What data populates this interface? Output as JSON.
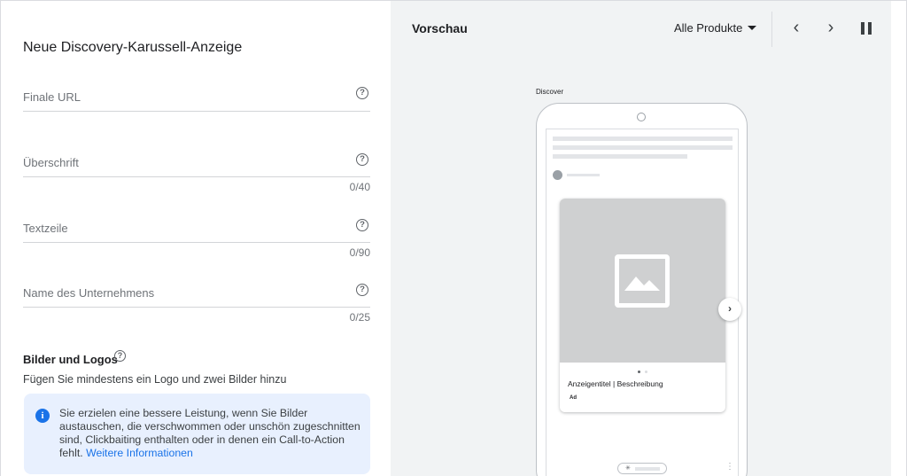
{
  "form": {
    "title": "Neue Discovery-Karussell-Anzeige",
    "fields": [
      {
        "label": "Finale URL",
        "counter": ""
      },
      {
        "label": "Überschrift",
        "counter": "0/40"
      },
      {
        "label": "Textzeile",
        "counter": "0/90"
      },
      {
        "label": "Name des Unternehmens",
        "counter": "0/25"
      }
    ],
    "help_glyph": "?",
    "images_section": {
      "title": "Bilder und Logos",
      "subtitle": "Fügen Sie mindestens ein Logo und zwei Bilder hinzu",
      "info_icon": "i",
      "info_text": "Sie erzielen eine bessere Leistung, wenn Sie Bilder austauschen, die verschwommen oder unschön zugeschnitten sind, Clickbaiting enthalten oder in denen ein Call-to-Action fehlt.",
      "info_link": "Weitere Informationen"
    }
  },
  "preview": {
    "title": "Vorschau",
    "product_select": "Alle Produkte",
    "prev_glyph": "‹",
    "next_glyph": "›",
    "discover_label": "Discover",
    "ad_headline": "Anzeigentitel | Beschreibung",
    "ad_badge": "Ad",
    "carousel_next_glyph": "›",
    "pill_glyph": "✳",
    "kebab_glyph": "⋮"
  },
  "icons": {
    "help": "help-circle-icon",
    "info": "info-icon",
    "dropdown": "dropdown-arrow-icon",
    "prev": "chevron-left-icon",
    "next": "chevron-right-icon",
    "pause": "pause-icon",
    "image_placeholder": "image-placeholder-icon"
  },
  "colors": {
    "accent": "#1a73e8",
    "info_background": "#e8f0fe",
    "preview_background": "#f1f3f4",
    "image_placeholder": "#cfd0d1"
  }
}
